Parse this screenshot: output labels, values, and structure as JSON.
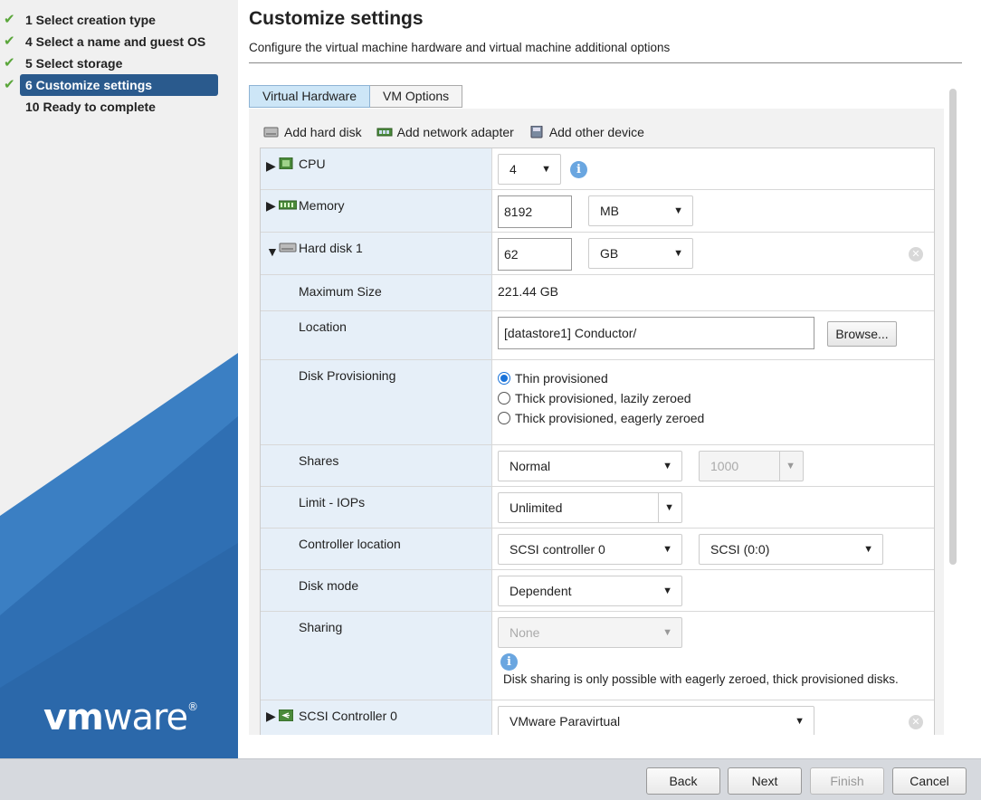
{
  "wizard": {
    "steps": [
      {
        "label": "1 Select creation type",
        "status": "done"
      },
      {
        "label": "4 Select a name and guest OS",
        "status": "done"
      },
      {
        "label": "5 Select storage",
        "status": "done"
      },
      {
        "label": "6 Customize settings",
        "status": "active"
      },
      {
        "label": "10 Ready to complete",
        "status": "pending"
      }
    ],
    "logo": {
      "bold": "vm",
      "rest": "ware",
      "mark": "®"
    }
  },
  "header": {
    "title": "Customize settings",
    "subtitle": "Configure the virtual machine hardware and virtual machine additional options"
  },
  "tabs": [
    {
      "label": "Virtual Hardware",
      "active": true
    },
    {
      "label": "VM Options",
      "active": false
    }
  ],
  "toolbar": {
    "add_hard_disk": "Add hard disk",
    "add_network_adapter": "Add network adapter",
    "add_other_device": "Add other device"
  },
  "hardware": {
    "cpu": {
      "label": "CPU",
      "value": "4"
    },
    "memory": {
      "label": "Memory",
      "value": "8192",
      "unit": "MB"
    },
    "hard_disk": {
      "label": "Hard disk 1",
      "size": "62",
      "unit": "GB",
      "max_size_label": "Maximum Size",
      "max_size": "221.44 GB",
      "location_label": "Location",
      "location": "[datastore1] Conductor/",
      "browse": "Browse...",
      "provisioning_label": "Disk Provisioning",
      "provisioning_options": [
        {
          "label": "Thin provisioned",
          "selected": true
        },
        {
          "label": "Thick provisioned, lazily zeroed",
          "selected": false
        },
        {
          "label": "Thick provisioned, eagerly zeroed",
          "selected": false
        }
      ],
      "shares_label": "Shares",
      "shares": "Normal",
      "shares_value": "1000",
      "limit_label": "Limit - IOPs",
      "limit": "Unlimited",
      "controller_label": "Controller location",
      "controller": "SCSI controller 0",
      "controller_slot": "SCSI (0:0)",
      "disk_mode_label": "Disk mode",
      "disk_mode": "Dependent",
      "sharing_label": "Sharing",
      "sharing": "None",
      "sharing_note": "Disk sharing is only possible with eagerly zeroed, thick provisioned disks."
    },
    "scsi": {
      "label": "SCSI Controller 0",
      "value": "VMware Paravirtual"
    }
  },
  "footer": {
    "back": "Back",
    "next": "Next",
    "finish": "Finish",
    "cancel": "Cancel"
  },
  "colors": {
    "active_step": "#2a5a8d",
    "check": "#5aa63a",
    "label_column": "#e6eff8",
    "tab_active": "#cde6f7",
    "radio_selected": "#1a73d9"
  }
}
